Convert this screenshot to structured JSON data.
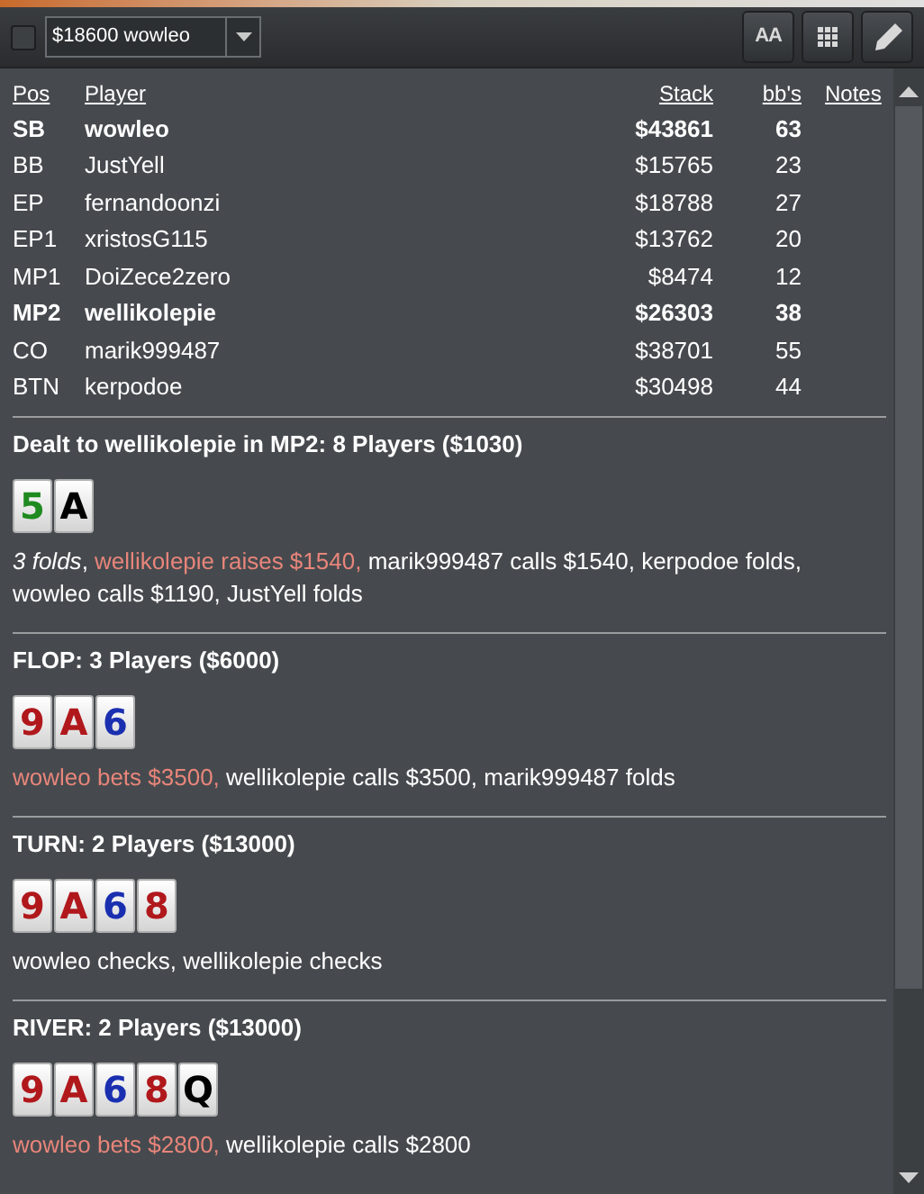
{
  "toolbar": {
    "checkbox": {
      "checked": false
    },
    "dropdown": {
      "value": "$18600 wowleo"
    },
    "buttons": [
      {
        "kind": "font",
        "label": "AA"
      },
      {
        "kind": "grid"
      },
      {
        "kind": "pencil"
      }
    ]
  },
  "players": {
    "columns": [
      {
        "label": "Pos"
      },
      {
        "label": "Player"
      },
      {
        "label": "Stack"
      },
      {
        "label": "bb's"
      },
      {
        "label": "Notes"
      }
    ],
    "rows": [
      {
        "pos": "SB",
        "player": "wowleo",
        "stack": "$43861",
        "bbs": "63",
        "bold": true
      },
      {
        "pos": "BB",
        "player": "JustYell",
        "stack": "$15765",
        "bbs": "23",
        "bold": false
      },
      {
        "pos": "EP",
        "player": "fernandoonzi",
        "stack": "$18788",
        "bbs": "27",
        "bold": false
      },
      {
        "pos": "EP1",
        "player": "xristosG115",
        "stack": "$13762",
        "bbs": "20",
        "bold": false
      },
      {
        "pos": "MP1",
        "player": "DoiZece2zero",
        "stack": "$8474",
        "bbs": "12",
        "bold": false
      },
      {
        "pos": "MP2",
        "player": "wellikolepie",
        "stack": "$26303",
        "bbs": "38",
        "bold": true
      },
      {
        "pos": "CO",
        "player": "marik999487",
        "stack": "$38701",
        "bbs": "55",
        "bold": false
      },
      {
        "pos": "BTN",
        "player": "kerpodoe",
        "stack": "$30498",
        "bbs": "44",
        "bold": false
      }
    ]
  },
  "streets": [
    {
      "heading": "Dealt to wellikolepie in MP2: 8 Players ($1030)",
      "cards": [
        {
          "rank": "5",
          "color": "#1f8a1f"
        },
        {
          "rank": "A",
          "color": "#000000"
        }
      ],
      "actions": [
        {
          "text": "3 folds",
          "kind": "folds"
        },
        {
          "text": ", ",
          "kind": "passive"
        },
        {
          "text": "wellikolepie raises $1540, ",
          "kind": "aggressive"
        },
        {
          "text": "marik999487 calls $1540, kerpodoe folds, wowleo calls $1190, JustYell folds",
          "kind": "passive"
        }
      ]
    },
    {
      "heading": "FLOP: 3 Players ($6000)",
      "cards": [
        {
          "rank": "9",
          "color": "#b0181c"
        },
        {
          "rank": "A",
          "color": "#b0181c"
        },
        {
          "rank": "6",
          "color": "#1a2fb0"
        }
      ],
      "actions": [
        {
          "text": "wowleo bets $3500, ",
          "kind": "aggressive"
        },
        {
          "text": "wellikolepie calls $3500, marik999487 folds",
          "kind": "passive"
        }
      ]
    },
    {
      "heading": "TURN: 2 Players ($13000)",
      "cards": [
        {
          "rank": "9",
          "color": "#b0181c"
        },
        {
          "rank": "A",
          "color": "#b0181c"
        },
        {
          "rank": "6",
          "color": "#1a2fb0"
        },
        {
          "rank": "8",
          "color": "#b0181c"
        }
      ],
      "actions": [
        {
          "text": "wowleo checks, wellikolepie checks",
          "kind": "passive"
        }
      ]
    },
    {
      "heading": "RIVER: 2 Players ($13000)",
      "cards": [
        {
          "rank": "9",
          "color": "#b0181c"
        },
        {
          "rank": "A",
          "color": "#b0181c"
        },
        {
          "rank": "6",
          "color": "#1a2fb0"
        },
        {
          "rank": "8",
          "color": "#b0181c"
        },
        {
          "rank": "Q",
          "color": "#000000"
        }
      ],
      "actions": [
        {
          "text": "wowleo bets $2800, ",
          "kind": "aggressive"
        },
        {
          "text": "wellikolepie calls $2800",
          "kind": "passive"
        }
      ]
    }
  ]
}
